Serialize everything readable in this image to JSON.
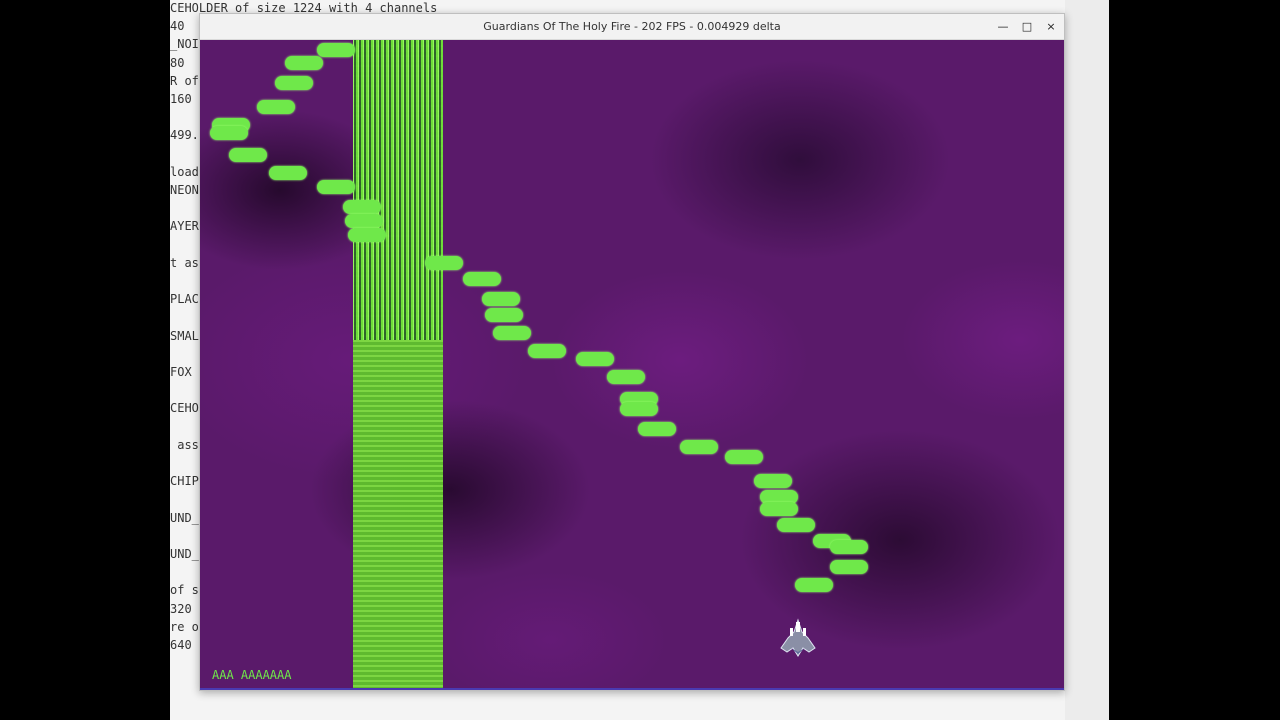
{
  "terminal": {
    "lines": [
      "CEHOLDER of size 1224 with 4 channels",
      "40",
      "_NOI",
      "80",
      "R of",
      "160",
      "",
      "499.",
      "",
      "load",
      "NEON",
      "",
      "AYER",
      "",
      "t as",
      "",
      "PLAC",
      "",
      "SMAL",
      "",
      "FOX",
      "",
      "CEHO",
      "",
      " ass",
      "",
      "CHIP",
      "",
      "UND_",
      "",
      "UND_",
      "",
      "of s",
      "320",
      "re o",
      "640"
    ]
  },
  "window": {
    "title": "Guardians Of The Holy Fire - 202 FPS - 0.004929 delta",
    "minimize_icon": "—",
    "maximize_icon": "□",
    "close_icon": "×"
  },
  "game": {
    "hud_text": "AAA AAAAAAA",
    "colors": {
      "bullet": "#6fe84a",
      "background": "#5a1a6a",
      "beam": "#7ee040"
    }
  }
}
